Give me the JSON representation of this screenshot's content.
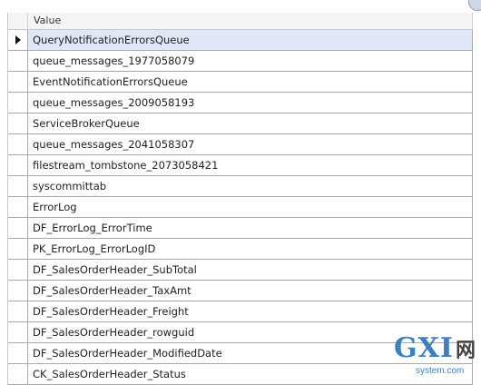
{
  "grid": {
    "column_header": "Value",
    "selected_index": 0,
    "rows": [
      "QueryNotificationErrorsQueue",
      "queue_messages_1977058079",
      "EventNotificationErrorsQueue",
      "queue_messages_2009058193",
      "ServiceBrokerQueue",
      "queue_messages_2041058307",
      "filestream_tombstone_2073058421",
      "syscommittab",
      "ErrorLog",
      "DF_ErrorLog_ErrorTime",
      "PK_ErrorLog_ErrorLogID",
      "DF_SalesOrderHeader_SubTotal",
      "DF_SalesOrderHeader_TaxAmt",
      "DF_SalesOrderHeader_Freight",
      "DF_SalesOrderHeader_rowguid",
      "DF_SalesOrderHeader_ModifiedDate",
      "CK_SalesOrderHeader_Status"
    ]
  },
  "watermark": {
    "logo_text": "GXI",
    "logo_suffix": "网",
    "site": "system.com"
  }
}
